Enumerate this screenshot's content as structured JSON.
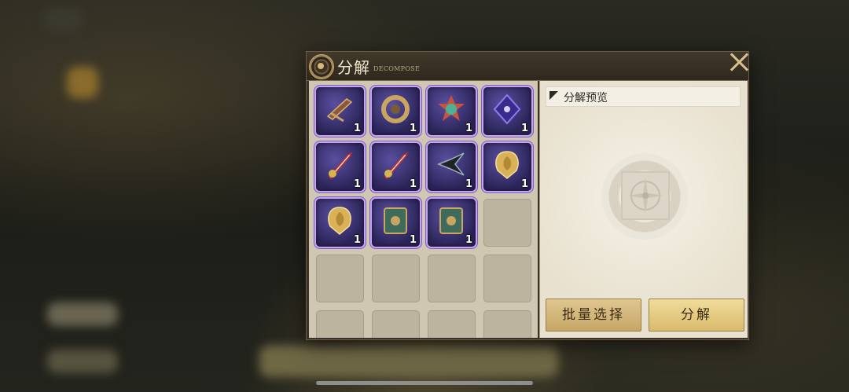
{
  "panel": {
    "title": "分解",
    "subtitle": "DECOMPOSE"
  },
  "inventory": {
    "items": [
      {
        "name": "bowgun",
        "count": "1"
      },
      {
        "name": "bronze-ring",
        "count": "1"
      },
      {
        "name": "feathered-amulet",
        "count": "1"
      },
      {
        "name": "violet-crystal",
        "count": "1"
      },
      {
        "name": "ornate-sword",
        "count": "1"
      },
      {
        "name": "ornate-sword",
        "count": "1"
      },
      {
        "name": "dark-crossbow",
        "count": "1"
      },
      {
        "name": "golden-shell-badge",
        "count": "1"
      },
      {
        "name": "golden-shell-badge",
        "count": "1"
      },
      {
        "name": "bronze-tome",
        "count": "1"
      },
      {
        "name": "bronze-tome",
        "count": "1"
      }
    ]
  },
  "preview": {
    "label": "分解预览"
  },
  "buttons": {
    "batch_select": "批量选择",
    "decompose": "分解"
  },
  "colors": {
    "rarity_frame": "#c9a4f2",
    "button_gold": "#d9bb6d",
    "panel_bg": "#3a3226"
  }
}
